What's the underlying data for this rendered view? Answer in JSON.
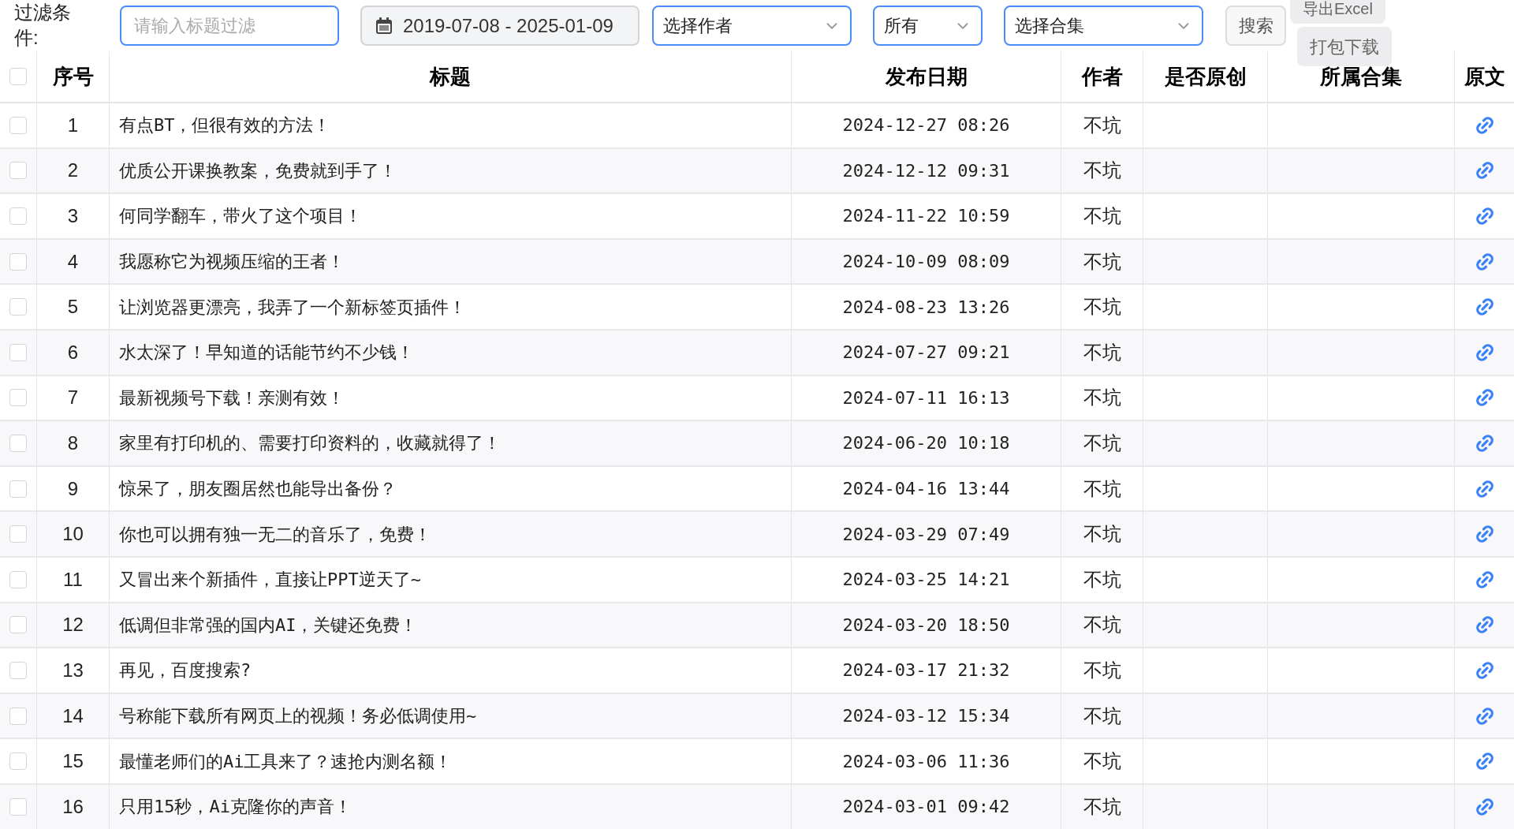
{
  "filter": {
    "label": "过滤条件:",
    "title_field": {
      "placeholder": "请输入标题过滤"
    },
    "date_range": "2019-07-08 - 2025-01-09",
    "author_select": "选择作者",
    "original_select": "所有",
    "collection_select": "选择合集",
    "search_button": "搜索",
    "export_button": "导出Excel",
    "download_button": "打包下载"
  },
  "table": {
    "select_all": {
      "checked": false
    },
    "columns": [
      "序号",
      "标题",
      "发布日期",
      "作者",
      "是否原创",
      "所属合集",
      "原文"
    ],
    "rows": [
      {
        "checked": false,
        "index": "1",
        "title": "有点BT，但很有效的方法！",
        "date": "2024-12-27 08:26",
        "author": "不坑"
      },
      {
        "checked": false,
        "index": "2",
        "title": "优质公开课换教案，免费就到手了！",
        "date": "2024-12-12 09:31",
        "author": "不坑"
      },
      {
        "checked": false,
        "index": "3",
        "title": "何同学翻车，带火了这个项目！",
        "date": "2024-11-22 10:59",
        "author": "不坑"
      },
      {
        "checked": false,
        "index": "4",
        "title": "我愿称它为视频压缩的王者！",
        "date": "2024-10-09 08:09",
        "author": "不坑"
      },
      {
        "checked": false,
        "index": "5",
        "title": "让浏览器更漂亮，我弄了一个新标签页插件！",
        "date": "2024-08-23 13:26",
        "author": "不坑"
      },
      {
        "checked": false,
        "index": "6",
        "title": "水太深了！早知道的话能节约不少钱！",
        "date": "2024-07-27 09:21",
        "author": "不坑"
      },
      {
        "checked": false,
        "index": "7",
        "title": "最新视频号下载！亲测有效！",
        "date": "2024-07-11 16:13",
        "author": "不坑"
      },
      {
        "checked": false,
        "index": "8",
        "title": "家里有打印机的、需要打印资料的，收藏就得了！",
        "date": "2024-06-20 10:18",
        "author": "不坑"
      },
      {
        "checked": false,
        "index": "9",
        "title": "惊呆了，朋友圈居然也能导出备份？",
        "date": "2024-04-16 13:44",
        "author": "不坑"
      },
      {
        "checked": false,
        "index": "10",
        "title": "你也可以拥有独一无二的音乐了，免费！",
        "date": "2024-03-29 07:49",
        "author": "不坑"
      },
      {
        "checked": false,
        "index": "11",
        "title": "又冒出来个新插件，直接让PPT逆天了~",
        "date": "2024-03-25 14:21",
        "author": "不坑"
      },
      {
        "checked": false,
        "index": "12",
        "title": "低调但非常强的国内AI，关键还免费！",
        "date": "2024-03-20 18:50",
        "author": "不坑"
      },
      {
        "checked": false,
        "index": "13",
        "title": "再见，百度搜索?",
        "date": "2024-03-17 21:32",
        "author": "不坑"
      },
      {
        "checked": false,
        "index": "14",
        "title": "号称能下载所有网页上的视频！务必低调使用~",
        "date": "2024-03-12 15:34",
        "author": "不坑"
      },
      {
        "checked": false,
        "index": "15",
        "title": "最懂老师们的Ai工具来了？速抢内测名额！",
        "date": "2024-03-06 11:36",
        "author": "不坑"
      },
      {
        "checked": false,
        "index": "16",
        "title": "只用15秒，Ai克隆你的声音！",
        "date": "2024-03-01 09:42",
        "author": "不坑"
      }
    ]
  }
}
